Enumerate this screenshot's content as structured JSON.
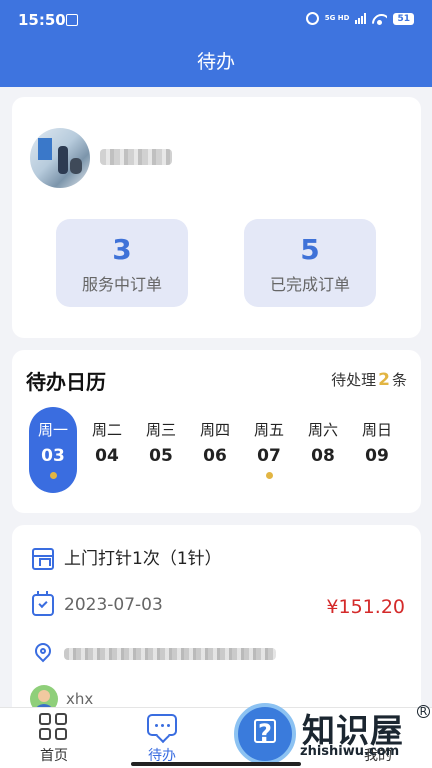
{
  "status_bar": {
    "time": "15:50",
    "network": "5G HD",
    "battery": "51"
  },
  "header": {
    "title": "待办"
  },
  "profile": {
    "stats": [
      {
        "value": "3",
        "label": "服务中订单"
      },
      {
        "value": "5",
        "label": "已完成订单"
      }
    ]
  },
  "calendar": {
    "title": "待办日历",
    "pending_prefix": "待处理",
    "pending_count": "2",
    "pending_suffix": "条",
    "days": [
      {
        "name": "周一",
        "num": "03",
        "has_task": true,
        "selected": true
      },
      {
        "name": "周二",
        "num": "04",
        "has_task": false,
        "selected": false
      },
      {
        "name": "周三",
        "num": "05",
        "has_task": false,
        "selected": false
      },
      {
        "name": "周四",
        "num": "06",
        "has_task": false,
        "selected": false
      },
      {
        "name": "周五",
        "num": "07",
        "has_task": true,
        "selected": false
      },
      {
        "name": "周六",
        "num": "08",
        "has_task": false,
        "selected": false
      },
      {
        "name": "周日",
        "num": "09",
        "has_task": false,
        "selected": false
      }
    ]
  },
  "order": {
    "service": "上门打针1次（1针）",
    "date": "2023-07-03",
    "price": "¥151.20",
    "user": "xhx"
  },
  "tabbar": {
    "tabs": [
      {
        "label": "首页",
        "active": false
      },
      {
        "label": "待办",
        "active": true
      },
      {
        "label": "",
        "active": false
      },
      {
        "label": "我的",
        "active": false
      }
    ]
  },
  "watermark": {
    "text": "知识屋",
    "sub": "zhishiwu.com",
    "registered": "R"
  },
  "colors": {
    "primary": "#3e74df",
    "accent": "#e2b543",
    "price": "#d42a2a"
  }
}
